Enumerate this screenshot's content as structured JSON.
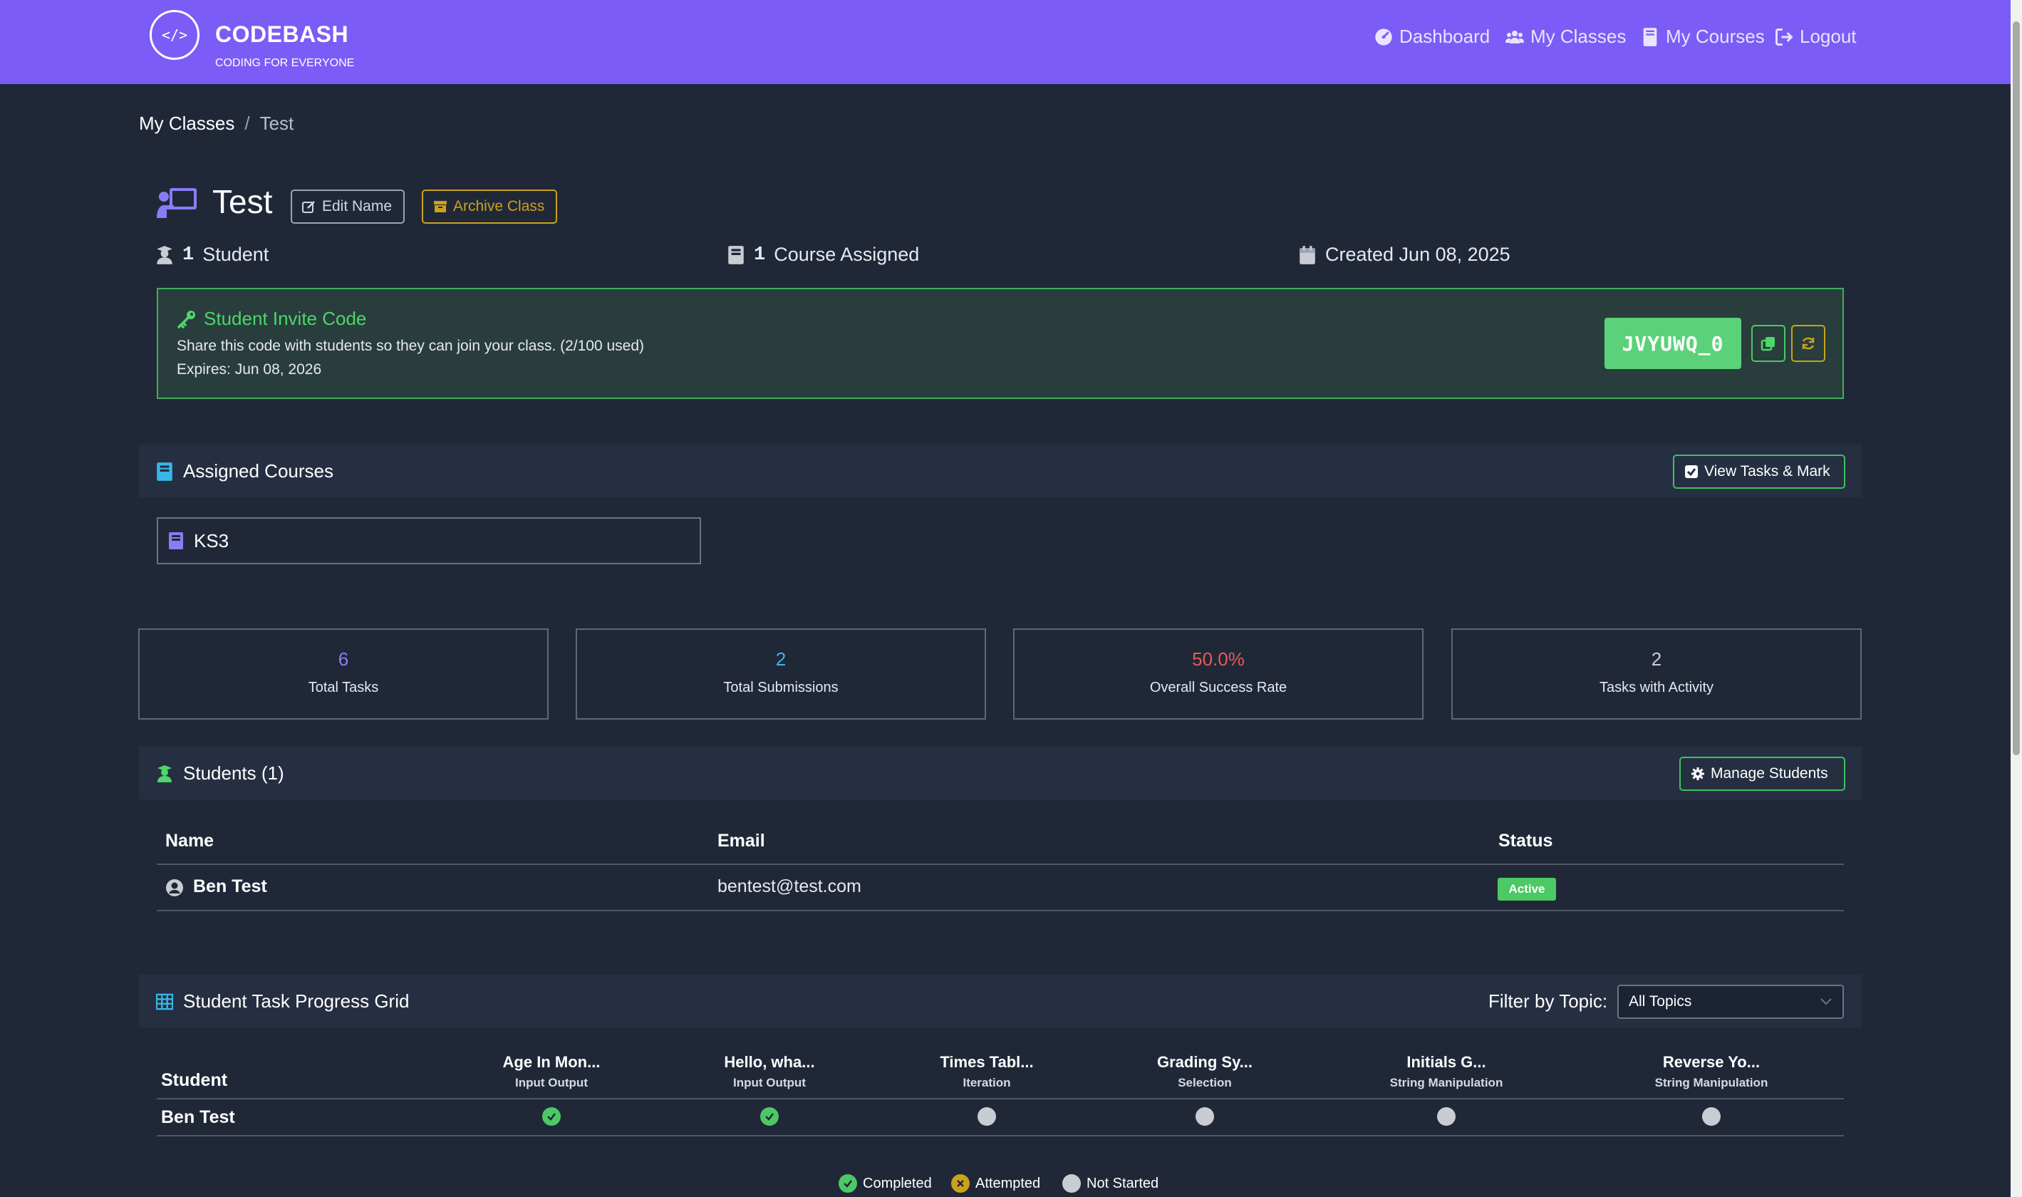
{
  "brand": {
    "name": "CODEBASH",
    "tagline": "CODING FOR EVERYONE",
    "logo_text": "</>"
  },
  "nav": [
    {
      "label": "Dashboard",
      "icon": "gauge-icon"
    },
    {
      "label": "My Classes",
      "icon": "users-icon"
    },
    {
      "label": "My Courses",
      "icon": "book-icon"
    },
    {
      "label": "Logout",
      "icon": "logout-icon"
    }
  ],
  "breadcrumb": {
    "parent": "My Classes",
    "separator": "/",
    "current": "Test"
  },
  "class": {
    "name": "Test",
    "edit_label": "Edit Name",
    "archive_label": "Archive Class",
    "students_count": "1",
    "students_label": "Student",
    "courses_count": "1",
    "courses_label": "Course Assigned",
    "created": "Created Jun 08, 2025"
  },
  "invite": {
    "title": "Student Invite Code",
    "description": "Share this code with students so they can join your class. (2/100 used)",
    "expires": "Expires: Jun 08, 2026",
    "code": "JVYUWQ_0"
  },
  "courses": {
    "title": "Assigned Courses",
    "button": "View Tasks & Mark",
    "items": [
      "KS3"
    ]
  },
  "stats": [
    {
      "value": "6",
      "label": "Total Tasks",
      "color": "#8b7cf6"
    },
    {
      "value": "2",
      "label": "Total Submissions",
      "color": "#38b6e8"
    },
    {
      "value": "50.0%",
      "label": "Overall Success Rate",
      "color": "#e85a5a"
    },
    {
      "value": "2",
      "label": "Tasks with Activity",
      "color": "#c9ccd3"
    }
  ],
  "students": {
    "title": "Students (1)",
    "button": "Manage Students",
    "columns": [
      "Name",
      "Email",
      "Status"
    ],
    "rows": [
      {
        "name": "Ben Test",
        "email": "bentest@test.com",
        "status": "Active"
      }
    ]
  },
  "grid": {
    "title": "Student Task Progress Grid",
    "filter_label": "Filter by Topic:",
    "filter_value": "All Topics",
    "student_col": "Student",
    "tasks": [
      {
        "name": "Age In Mon...",
        "topic": "Input Output"
      },
      {
        "name": "Hello, wha...",
        "topic": "Input Output"
      },
      {
        "name": "Times Tabl...",
        "topic": "Iteration"
      },
      {
        "name": "Grading Sy...",
        "topic": "Selection"
      },
      {
        "name": "Initials G...",
        "topic": "String Manipulation"
      },
      {
        "name": "Reverse Yo...",
        "topic": "String Manipulation"
      }
    ],
    "rows": [
      {
        "student": "Ben Test",
        "statuses": [
          "completed",
          "completed",
          "not_started",
          "not_started",
          "not_started",
          "not_started"
        ]
      }
    ],
    "legend": {
      "completed": "Completed",
      "attempted": "Attempted",
      "not_started": "Not Started"
    }
  },
  "colors": {
    "navbar": "#7b5cf6",
    "accent_green": "#4cc865",
    "warning": "#caa21a",
    "background": "#202838"
  }
}
